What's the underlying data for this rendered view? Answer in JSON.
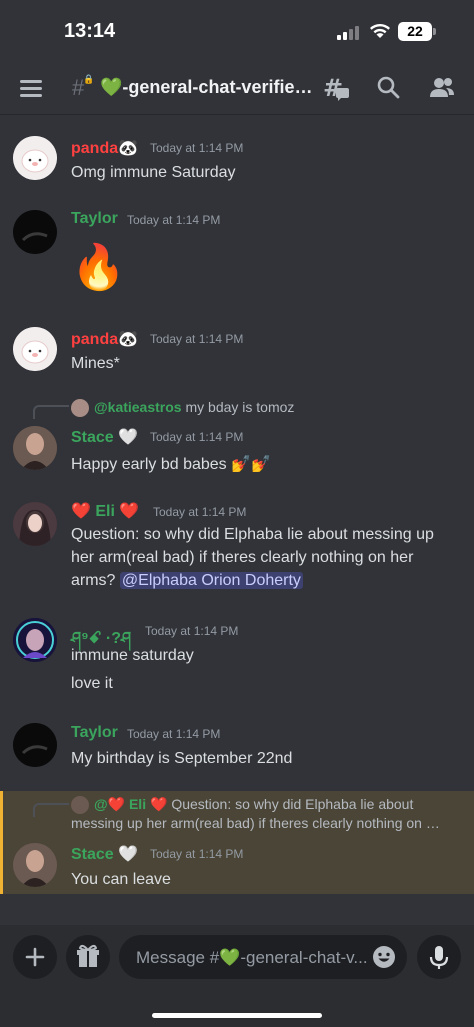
{
  "status": {
    "time": "13:14",
    "battery": "22"
  },
  "header": {
    "channel": "💚-general-chat-verifie…"
  },
  "colors": {
    "panda": "#ff4040",
    "green": "#3ba55d",
    "accent": "#f0b232"
  },
  "messages": [
    {
      "name": "panda",
      "name_suffix": "🐼",
      "time": "Today at 1:14 PM",
      "lines": [
        "Omg immune Saturday"
      ]
    },
    {
      "name": "Taylor",
      "time": "Today at 1:14 PM",
      "emoji": "🔥"
    },
    {
      "name": "panda",
      "name_suffix": "🐼",
      "time": "Today at 1:14 PM",
      "lines": [
        "Mines*"
      ]
    },
    {
      "reply_user": "@katieastros",
      "reply_text": "my bday is tomoz",
      "name": "Stace",
      "name_suffix": "🤍",
      "time": "Today at 1:14 PM",
      "lines": [
        "Happy early bd babes 💅💅"
      ]
    },
    {
      "name_prefix": "❤️",
      "name": "Eli",
      "name_suffix": "❤️",
      "time": "Today at 1:14 PM",
      "line1": "Question: so why did Elphaba lie about messing up",
      "line2": "her arm(real bad) if theres clearly nothing on her",
      "line3_pre": "arms?",
      "mention": "@Elphaba Orion Doherty"
    },
    {
      "name": "ཤ⁹ꗃ ·?ཤ",
      "time": "Today at 1:14 PM",
      "lines": [
        "immune saturday",
        "love it"
      ]
    },
    {
      "name": "Taylor",
      "time": "Today at 1:14 PM",
      "lines": [
        "My birthday is September 22nd"
      ]
    },
    {
      "reply_user": "@❤️ Eli ❤️",
      "reply_text": "Question: so why did Elphaba lie about",
      "reply_text2": "messing up her arm(real bad) if theres clearly nothing on …",
      "name": "Stace",
      "name_suffix": "🤍",
      "time": "Today at 1:14 PM",
      "lines": [
        "You can leave"
      ]
    }
  ],
  "composer": {
    "placeholder": "Message #💚-general-chat-v..."
  }
}
